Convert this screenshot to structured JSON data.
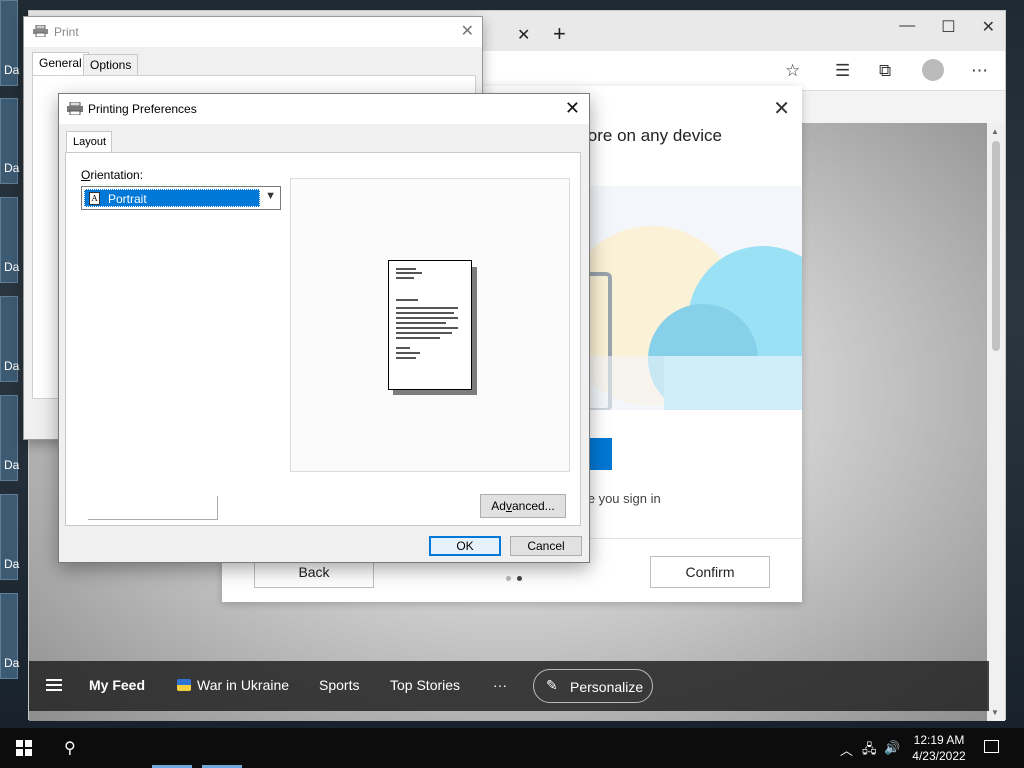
{
  "desktop": {
    "icon_label": "Da",
    "icon_count": 7
  },
  "browser": {
    "tab_close": "✕",
    "new_tab": "+",
    "window_controls": [
      "—",
      "☐",
      "✕"
    ],
    "toolbar_icons": [
      "☆",
      "☰",
      "⧉",
      "⋯"
    ],
    "sync_dialog": {
      "close": "✕",
      "heading": "ore on any device",
      "signin_text": "nce you sign in",
      "back_label": "Back",
      "confirm_label": "Confirm",
      "page_index": 2,
      "page_total": 2
    },
    "feed_bar": {
      "items": [
        "My Feed",
        "War in Ukraine",
        "Sports",
        "Top Stories",
        "···"
      ],
      "personalize_label": "Personalize"
    }
  },
  "print_dialog": {
    "title": "Print",
    "close": "✕",
    "tabs": [
      "General",
      "Options"
    ]
  },
  "prefs_dialog": {
    "title": "Printing Preferences",
    "close": "✕",
    "tab": "Layout",
    "orientation_label_first": "O",
    "orientation_label_rest": "rientation:",
    "orientation_value": "Portrait",
    "orientation_icon_letter": "A",
    "advanced_first": "Ad",
    "advanced_underlined": "v",
    "advanced_rest": "anced...",
    "ok_label": "OK",
    "cancel_label": "Cancel"
  },
  "taskbar": {
    "time": "12:19 AM",
    "date": "4/23/2022",
    "tray_chevron": "︿",
    "tray_network": "🖧",
    "tray_volume": "🔊"
  },
  "colors": {
    "accent": "#0078d7",
    "brand_blue": "#0078d4",
    "taskbar": "#0c0c0c"
  }
}
